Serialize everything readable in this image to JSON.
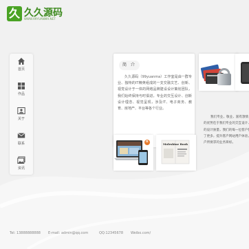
{
  "logo": {
    "mark": "久",
    "name": "久久源码",
    "subtitle": "WWW.99YUANMA.NET"
  },
  "nav": [
    {
      "label": "首页",
      "icon": "home-icon"
    },
    {
      "label": "作品",
      "icon": "grid-icon"
    },
    {
      "label": "关于",
      "icon": "person-card-icon"
    },
    {
      "label": "联系",
      "icon": "envelope-icon"
    },
    {
      "label": "资讯",
      "icon": "image-icon"
    }
  ],
  "intro": {
    "title": "简 介",
    "text": "久久源码（99yuanma）工作室是由一群专业、独特的IT精英组成的一支交融文艺、创新、视觉设计于一体的网络品牌建设设计策划团队，我们始终保持与时俱进，专业的交互设计、创新设计理念、视觉呈现，涉及IT、电子商务、教育、房地产、平台等各个行业。"
  },
  "right_text": "我们专业，敬业，富有激情；我们的优势在于我们专业的交互设计、商业的设计质量，我们的每一位客户都得到了更多，提升客户网站用户体验，并客户所要求的业务目标。",
  "laptop_badge": "n",
  "book_label": "Moleskine Book",
  "footer": {
    "tel": "Tel: 13888888888",
    "email": "E-mail: admin@qq.com",
    "qq": "QQ:12345678",
    "weibo": "Weibo.com/"
  }
}
